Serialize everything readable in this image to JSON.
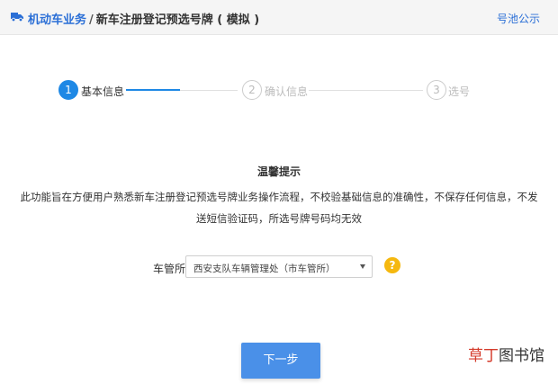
{
  "header": {
    "breadcrumb_main": "机动车业务",
    "breadcrumb_sep": "/",
    "breadcrumb_sub": "新车注册登记预选号牌 ( 模拟 )",
    "pool_link": "号池公示",
    "icon": "truck-icon"
  },
  "stepper": {
    "steps": [
      {
        "number": "1",
        "label": "基本信息",
        "state": "active"
      },
      {
        "number": "2",
        "label": "确认信息",
        "state": "inactive"
      },
      {
        "number": "3",
        "label": "选号",
        "state": "inactive"
      }
    ],
    "accent": "#1e88e5"
  },
  "notice": {
    "title": "温馨提示",
    "body": "此功能旨在方便用户熟悉新车注册登记预选号牌业务操作流程，不校验基础信息的准确性，不保存任何信息，不发送短信验证码，所选号牌号码均无效"
  },
  "form": {
    "office_label": "车管所",
    "office_value": "西安支队车辆管理处（市车管所）",
    "help_symbol": "?"
  },
  "actions": {
    "next_label": "下一步"
  },
  "watermark": {
    "part1": "草丁",
    "part2": "图书馆"
  },
  "colors": {
    "brand_blue": "#2b6fd6",
    "button_blue": "#4a90e8",
    "help_yellow": "#f5b80f"
  }
}
